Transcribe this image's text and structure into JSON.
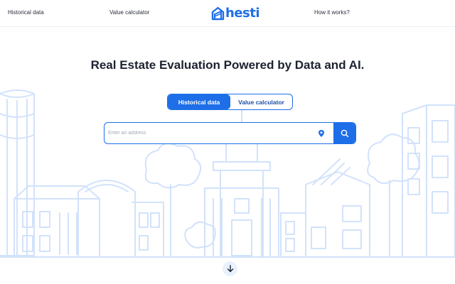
{
  "header": {
    "nav_historical": "Historical data",
    "nav_calculator": "Value calculator",
    "nav_how": "How it works?",
    "logo_text": "hesti",
    "logo_icon": "house-logo-icon"
  },
  "hero": {
    "title": "Real Estate Evaluation Powered by Data and AI.",
    "tabs": [
      {
        "label": "Historical data",
        "active": true
      },
      {
        "label": "Value calculator",
        "active": false
      }
    ]
  },
  "search": {
    "placeholder": "Enter an address",
    "value": "",
    "location_icon": "map-pin-icon",
    "button_icon": "search-icon"
  },
  "scroll": {
    "icon": "arrow-down-icon"
  },
  "colors": {
    "accent": "#1e6ee8",
    "illustration": "#d2e2fb",
    "text": "#1c2230",
    "border": "#eceff3"
  }
}
